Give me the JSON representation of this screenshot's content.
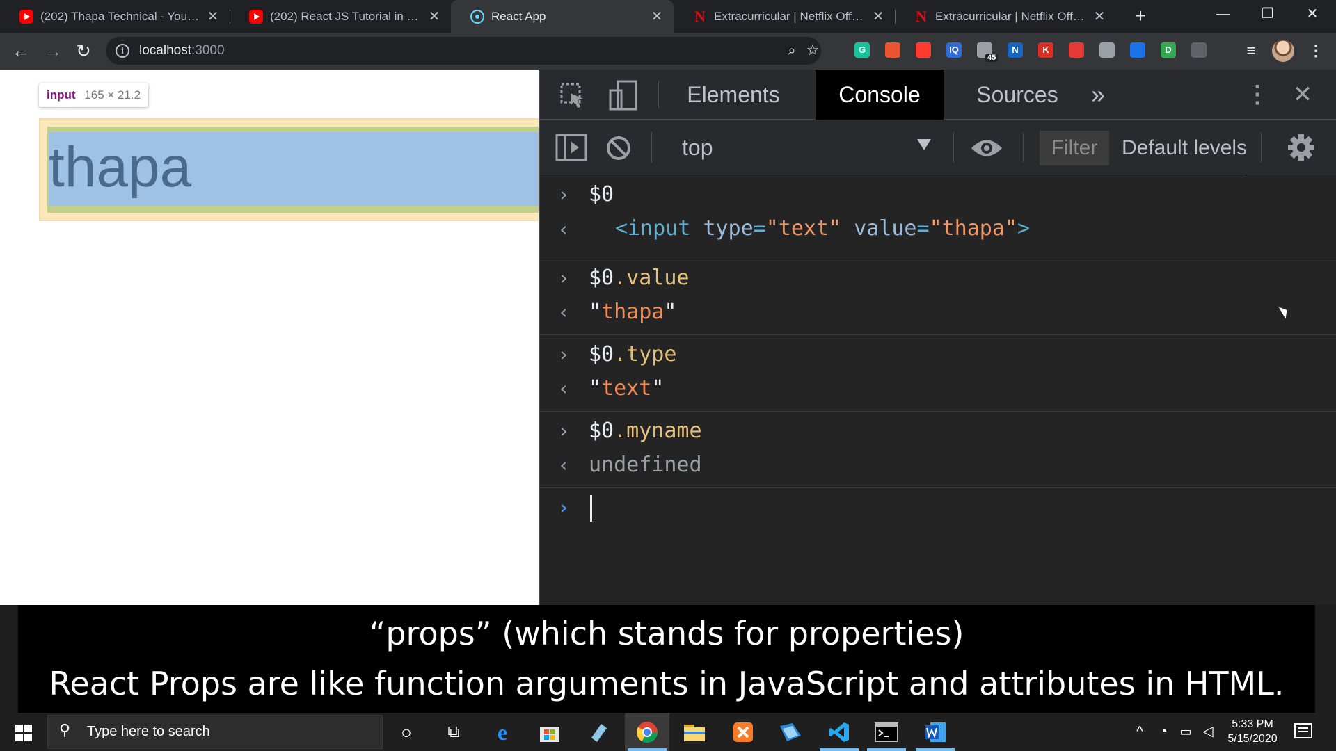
{
  "browser": {
    "tabs": [
      {
        "title": "(202) Thapa Technical - YouTube",
        "favicon": "youtube-icon",
        "active": false
      },
      {
        "title": "(202) React JS Tutorial in Hindi",
        "favicon": "youtube-icon",
        "active": false
      },
      {
        "title": "React App",
        "favicon": "react-icon",
        "active": true
      },
      {
        "title": "Extracurricular | Netflix Official",
        "favicon": "netflix-icon",
        "active": false
      },
      {
        "title": "Extracurricular | Netflix Official",
        "favicon": "netflix-icon",
        "active": false
      }
    ],
    "tab_close_glyph": "✕",
    "new_tab_glyph": "+",
    "window_controls": {
      "minimize": "—",
      "restore": "❐",
      "close": "✕"
    },
    "nav": {
      "back": "←",
      "forward": "→",
      "reload": "↻"
    },
    "address": {
      "host": "localhost",
      "port": ":3000"
    },
    "extension_badge": "45",
    "extensions": [
      {
        "label": "G",
        "color": "#15c39a"
      },
      {
        "label": "",
        "color": "#e8542f"
      },
      {
        "label": "",
        "color": "#ff3b30"
      },
      {
        "label": "IQ",
        "color": "#2f6bd8"
      },
      {
        "label": "",
        "color": "#9aa0a6"
      },
      {
        "label": "N",
        "color": "#1565c0"
      },
      {
        "label": "K",
        "color": "#d93025"
      },
      {
        "label": "",
        "color": "#e53935"
      },
      {
        "label": "",
        "color": "#9aa0a6"
      },
      {
        "label": "",
        "color": "#1a73e8"
      },
      {
        "label": "D",
        "color": "#34a853"
      },
      {
        "label": "",
        "color": "#5f6368"
      }
    ]
  },
  "page": {
    "tooltip": {
      "tag": "input",
      "dims": "165 × 21.2"
    },
    "input_value": "thapa"
  },
  "devtools": {
    "tabs": [
      "Elements",
      "Console",
      "Sources"
    ],
    "active_tab": "Console",
    "more_tabs_glyph": "»",
    "context": "top",
    "filter_placeholder": "Filter",
    "levels": "Default levels",
    "console": [
      {
        "kind": "input",
        "base": "$0",
        "prop": ""
      },
      {
        "kind": "element",
        "tag_open": "<input",
        "attr1": "type",
        "val1": "\"text\"",
        "attr2": "value",
        "val2": "\"thapa\"",
        "tag_close": ">"
      },
      {
        "kind": "input",
        "base": "$0",
        "prop": ".value"
      },
      {
        "kind": "string",
        "value": "thapa"
      },
      {
        "kind": "input",
        "base": "$0",
        "prop": ".type"
      },
      {
        "kind": "string",
        "value": "text"
      },
      {
        "kind": "input",
        "base": "$0",
        "prop": ".myname"
      },
      {
        "kind": "undefined",
        "value": "undefined"
      }
    ],
    "input_arrow": "›",
    "output_arrow": "‹"
  },
  "subtitle": {
    "line1": "“props” (which stands for properties)",
    "line2": "React Props are like function arguments in JavaScript and attributes in HTML."
  },
  "taskbar": {
    "search_placeholder": "Type here to search",
    "time": "5:33 PM",
    "date": "5/15/2020"
  }
}
